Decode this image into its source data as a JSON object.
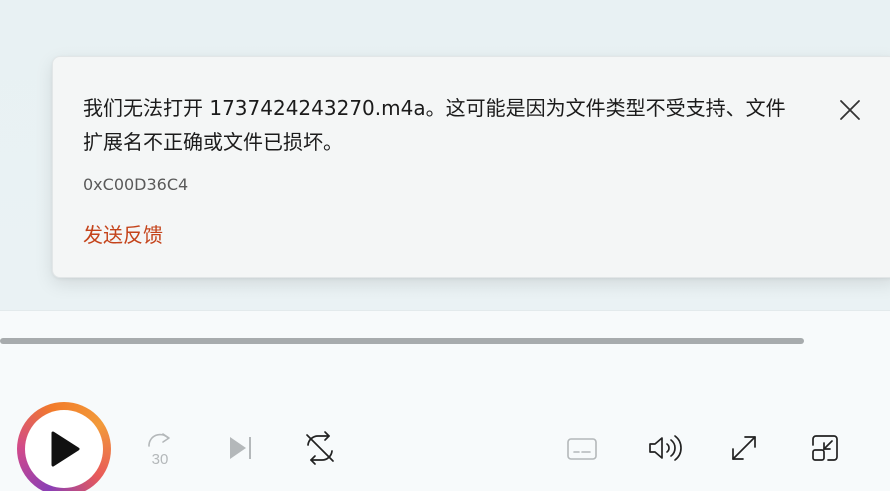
{
  "error": {
    "message": "我们无法打开 1737424243270.m4a。这可能是因为文件类型不受支持、文件扩展名不正确或文件已损坏。",
    "code": "0xC00D36C4",
    "feedback_label": "发送反馈"
  },
  "player": {
    "skip_forward_label": "30"
  },
  "colors": {
    "accent": "#c4431a",
    "seek_track": "#a7abad"
  },
  "icons": [
    "close-icon",
    "play-icon",
    "skip-forward-30-icon",
    "next-track-icon",
    "repeat-off-icon",
    "captions-icon",
    "volume-icon",
    "fullscreen-icon",
    "mini-player-icon"
  ]
}
